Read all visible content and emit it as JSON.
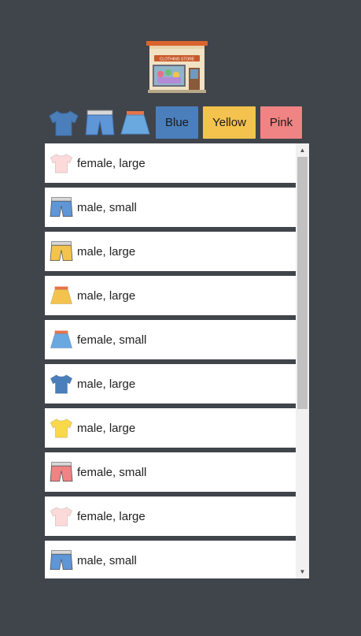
{
  "store_sign": "CLOTHING STORE",
  "toolbar": {
    "icons": [
      "tshirt-icon",
      "shorts-icon",
      "skirt-icon"
    ],
    "buttons": [
      {
        "label": "Blue",
        "color": "#4a7fbc"
      },
      {
        "label": "Yellow",
        "color": "#f3c34d"
      },
      {
        "label": "Pink",
        "color": "#f08383"
      }
    ]
  },
  "items": [
    {
      "icon": "tshirt-icon",
      "color": "#fcdada",
      "label": "female, large"
    },
    {
      "icon": "shorts-icon",
      "color": "#5e96d8",
      "label": "male, small"
    },
    {
      "icon": "shorts-icon",
      "color": "#f3c34d",
      "label": "male, large"
    },
    {
      "icon": "skirt-icon",
      "color": "#f3c34d",
      "label": "male, large"
    },
    {
      "icon": "skirt-icon",
      "color": "#6aa8e0",
      "label": "female, small"
    },
    {
      "icon": "tshirt-icon",
      "color": "#4a7fbc",
      "label": "male, large"
    },
    {
      "icon": "tshirt-icon",
      "color": "#f9d84a",
      "label": "male, large"
    },
    {
      "icon": "shorts-icon",
      "color": "#f08383",
      "label": "female, small"
    },
    {
      "icon": "tshirt-icon",
      "color": "#fcdada",
      "label": "female, large"
    },
    {
      "icon": "shorts-icon",
      "color": "#5e96d8",
      "label": "male, small"
    }
  ]
}
